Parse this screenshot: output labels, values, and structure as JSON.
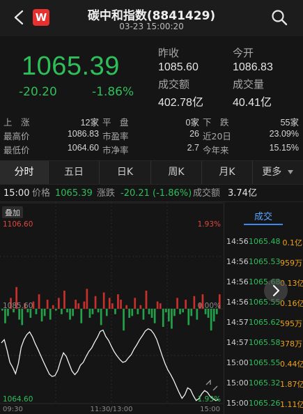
{
  "header": {
    "title": "碳中和指数(8841429)",
    "datetime": "03-23 15:00:20",
    "logo_letter": "W",
    "icons": [
      "back-icon",
      "app-logo",
      "search-icon"
    ]
  },
  "quote": {
    "last": "1065.39",
    "change": "-20.20",
    "change_pct": "-1.86%",
    "prev_close_label": "昨收",
    "prev_close": "1085.60",
    "open_label": "今开",
    "open": "1086.83",
    "amount_label": "成交额",
    "amount": "402.78亿",
    "volume_label": "成交量",
    "volume": "40.41亿"
  },
  "stats": {
    "row1": {
      "a_lab": "上　涨",
      "a_val": "12家",
      "b_lab": "平　盘",
      "b_val": "0家",
      "c_lab": "下　跌",
      "c_val": "55家"
    },
    "row2": {
      "a_lab": "最高价",
      "a_val": "1086.83",
      "b_lab": "市盈率",
      "b_val": "26",
      "c_lab": "近20日",
      "c_val": "23.09%"
    },
    "row3": {
      "a_lab": "最低价",
      "a_val": "1064.60",
      "b_lab": "市净率",
      "b_val": "2.7",
      "c_lab": "今年来",
      "c_val": "15.15%"
    }
  },
  "tabs": [
    "分时",
    "五日",
    "日K",
    "周K",
    "月K",
    "更多"
  ],
  "info": {
    "time": "15:00",
    "price_label": "价格",
    "price": "1065.39",
    "chg_label": "涨跌",
    "chg": "-20.21 (-1.86%)",
    "amt_label": "成交额",
    "amt": "3.74亿"
  },
  "chart_labels": {
    "max_price": "1106.60",
    "max_pct": "1.93%",
    "mid_price": "1085.60",
    "mid_pct": "0.00%",
    "min_price": "1064.60",
    "min_pct": "-1.93%",
    "overlay": "叠加",
    "t_start": "09:30",
    "t_mid": "11:30/13:00",
    "t_end": "15:00"
  },
  "chart_data": {
    "type": "line",
    "y_range": [
      1064.6,
      1106.6
    ],
    "base": 1085.6,
    "price_line": [
      1077.8,
      1078.5,
      1076.2,
      1073.5,
      1072.4,
      1071.0,
      1073.2,
      1076.8,
      1078.5,
      1079.6,
      1080.2,
      1079.1,
      1077.6,
      1076.3,
      1074.9,
      1073.5,
      1072.2,
      1070.9,
      1070.4,
      1070.6,
      1071.8,
      1073.9,
      1075.6,
      1074.8,
      1073.2,
      1071.6,
      1070.8,
      1071.5,
      1072.9,
      1073.5,
      1074.8,
      1075.9,
      1076.7,
      1077.9,
      1079.0,
      1080.3,
      1080.6,
      1079.2,
      1078.3,
      1077.0,
      1075.8,
      1074.9,
      1074.1,
      1073.5,
      1073.7,
      1074.5,
      1075.2,
      1076.4,
      1077.4,
      1078.5,
      1079.4,
      1080.4,
      1080.9,
      1080.6,
      1079.8,
      1078.6,
      1076.8,
      1074.9,
      1073.2,
      1071.8,
      1070.8,
      1069.6,
      1068.2,
      1066.8,
      1065.6,
      1066.4,
      1067.9,
      1067.5,
      1066.2,
      1065.1,
      1065.5,
      1066.6,
      1067.3,
      1066.9,
      1066.0,
      1065.5,
      1065.1,
      1065.4
    ],
    "volume_bars": [
      -1,
      -8,
      -4,
      6,
      -2,
      12,
      -6,
      -9,
      3,
      -2,
      -5,
      4,
      -3,
      8,
      -7,
      -4,
      5,
      -6,
      2,
      -1,
      6,
      -3,
      10,
      -2,
      -6,
      -4,
      5,
      3,
      -8,
      4,
      11,
      -5,
      -3,
      7,
      -2,
      -9,
      9,
      -4,
      6,
      3,
      -3,
      8,
      5,
      -12,
      2,
      -5,
      -4,
      6,
      -3,
      2,
      -6,
      10,
      -3,
      -5,
      -8,
      4,
      3,
      -10,
      -2,
      -7,
      -11,
      -4,
      6,
      -3,
      -2,
      5,
      -9,
      -4,
      7,
      -6,
      3,
      8,
      -3,
      -5,
      -12,
      -7,
      -3,
      8
    ]
  },
  "side": {
    "tab": "成交",
    "trades": [
      {
        "time": "14:56",
        "price": "1065.48",
        "vol": "0.1亿"
      },
      {
        "time": "14:56",
        "price": "1065.53",
        "vol": "959万"
      },
      {
        "time": "14:56",
        "price": "1065.68",
        "vol": "0.13亿"
      },
      {
        "time": "14:56",
        "price": "1065.55",
        "vol": "0.16亿"
      },
      {
        "time": "14:57",
        "price": "1065.62",
        "vol": "595万"
      },
      {
        "time": "14:57",
        "price": "1065.58",
        "vol": "378万"
      },
      {
        "time": "15:00",
        "price": "1065.55",
        "vol": "0.44亿"
      },
      {
        "time": "15:00",
        "price": "1065.32",
        "vol": "1.87亿"
      },
      {
        "time": "15:00",
        "price": "1065.26",
        "vol": "1.11亿"
      }
    ]
  }
}
